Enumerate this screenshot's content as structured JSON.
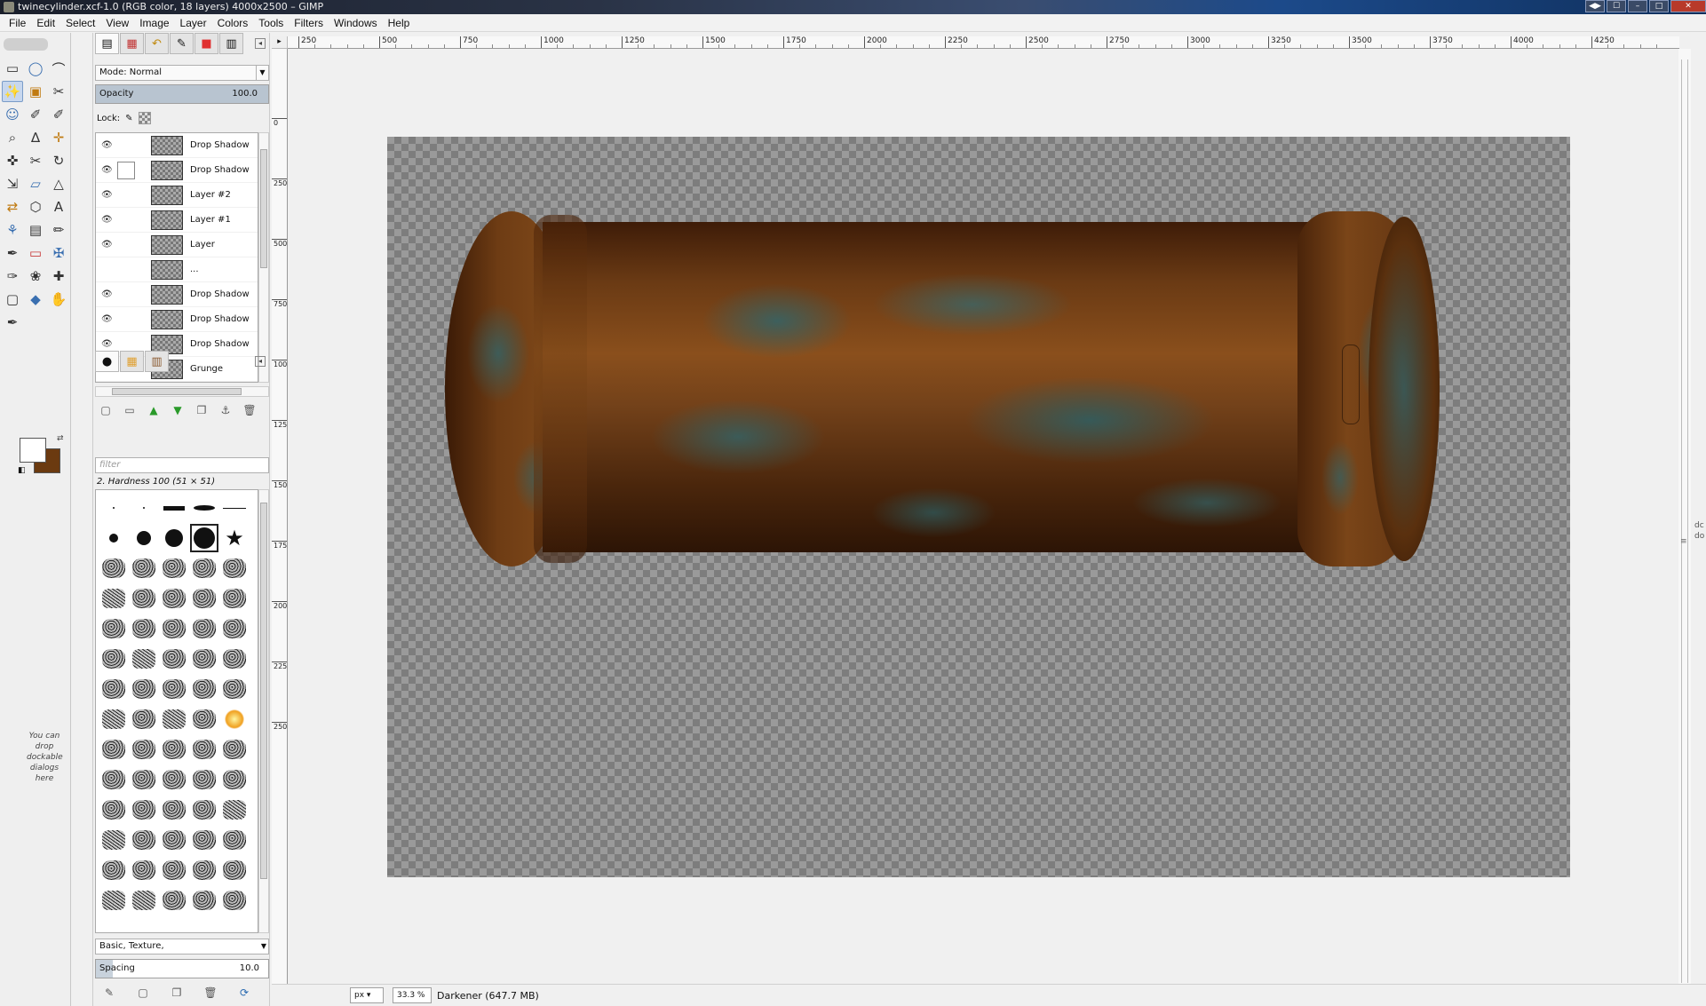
{
  "window": {
    "title": "twinecylinder.xcf-1.0 (RGB color, 18 layers) 4000x2500 – GIMP",
    "controls": [
      "◀▶",
      "☐",
      "–",
      "□",
      "✕"
    ]
  },
  "menubar": [
    "File",
    "Edit",
    "Select",
    "View",
    "Image",
    "Layer",
    "Colors",
    "Tools",
    "Filters",
    "Windows",
    "Help"
  ],
  "toolbox": {
    "tools": [
      {
        "name": "rect-select-icon",
        "glyph": "▭"
      },
      {
        "name": "ellipse-select-icon",
        "glyph": "◯"
      },
      {
        "name": "free-select-icon",
        "glyph": "⌒"
      },
      {
        "name": "fuzzy-select-icon",
        "glyph": "✨",
        "active": true
      },
      {
        "name": "color-select-icon",
        "glyph": "▣"
      },
      {
        "name": "scissors-icon",
        "glyph": "✂"
      },
      {
        "name": "foreground-select-icon",
        "glyph": "☺"
      },
      {
        "name": "paths-icon",
        "glyph": "✐"
      },
      {
        "name": "color-picker-icon",
        "glyph": "✐"
      },
      {
        "name": "zoom-icon",
        "glyph": "⌕"
      },
      {
        "name": "measure-icon",
        "glyph": "∆"
      },
      {
        "name": "move-icon",
        "glyph": "✛"
      },
      {
        "name": "align-icon",
        "glyph": "✜"
      },
      {
        "name": "crop-icon",
        "glyph": "✂"
      },
      {
        "name": "rotate-icon",
        "glyph": "↻"
      },
      {
        "name": "scale-icon",
        "glyph": "⇲"
      },
      {
        "name": "shear-icon",
        "glyph": "▱"
      },
      {
        "name": "perspective-icon",
        "glyph": "△"
      },
      {
        "name": "flip-icon",
        "glyph": "⇄"
      },
      {
        "name": "cage-transform-icon",
        "glyph": "⬡"
      },
      {
        "name": "text-icon",
        "glyph": "A"
      },
      {
        "name": "bucket-fill-icon",
        "glyph": "⚘"
      },
      {
        "name": "gradient-icon",
        "glyph": "▤"
      },
      {
        "name": "pencil-icon",
        "glyph": "✏"
      },
      {
        "name": "paintbrush-icon",
        "glyph": "✒"
      },
      {
        "name": "eraser-icon",
        "glyph": "▭"
      },
      {
        "name": "airbrush-icon",
        "glyph": "✠"
      },
      {
        "name": "ink-icon",
        "glyph": "✑"
      },
      {
        "name": "clone-icon",
        "glyph": "❀"
      },
      {
        "name": "heal-icon",
        "glyph": "✚"
      },
      {
        "name": "perspective-clone-icon",
        "glyph": "▢"
      },
      {
        "name": "blur-icon",
        "glyph": "◆"
      },
      {
        "name": "smudge-icon",
        "glyph": "✋"
      },
      {
        "name": "dodge-burn-icon",
        "glyph": "✒"
      }
    ],
    "drop_hint": "You can drop dockable dialogs here"
  },
  "layers_panel": {
    "mode_label": "Mode: Normal",
    "opacity_label": "Opacity",
    "opacity_value": "100.0",
    "opacity_fraction": 1.0,
    "lock_label": "Lock:",
    "layers": [
      {
        "name": "Drop Shadow",
        "visible": true,
        "linked": false
      },
      {
        "name": "Drop Shadow",
        "visible": true,
        "linked": true
      },
      {
        "name": "Layer #2",
        "visible": true,
        "linked": false
      },
      {
        "name": "Layer #1",
        "visible": true,
        "linked": false
      },
      {
        "name": "Layer",
        "visible": true,
        "linked": false
      },
      {
        "name": "...",
        "visible": false,
        "linked": false
      },
      {
        "name": "Drop Shadow",
        "visible": true,
        "linked": false
      },
      {
        "name": "Drop Shadow",
        "visible": true,
        "linked": false
      },
      {
        "name": "Drop Shadow",
        "visible": true,
        "linked": false
      },
      {
        "name": "Grunge",
        "visible": false,
        "linked": false
      }
    ]
  },
  "brushes_panel": {
    "filter_placeholder": "filter",
    "selected_brush": "2. Hardness 100 (51 × 51)",
    "tags_value": "Basic, Texture,",
    "spacing_label": "Spacing",
    "spacing_value": "10.0",
    "spacing_fraction": 0.1
  },
  "rulers": {
    "horizontal_labels": [
      "250",
      "500",
      "750",
      "1000",
      "1250",
      "1500",
      "1750",
      "2000",
      "2250",
      "2500",
      "2750",
      "3000",
      "3250",
      "3500",
      "3750",
      "4000",
      "4250"
    ],
    "vertical_labels": [
      "0",
      "250",
      "500",
      "750",
      "1000",
      "1250",
      "1500",
      "1750",
      "2000",
      "2250",
      "2500"
    ]
  },
  "statusbar": {
    "unit": "px",
    "zoom": "33.3 %",
    "message": "Darkener (647.7 MB)"
  },
  "colors": {
    "foreground": "#ffffff",
    "background": "#6b3a10",
    "accent": "#3a6fb0"
  },
  "right_edge_text": "dc\ndo"
}
